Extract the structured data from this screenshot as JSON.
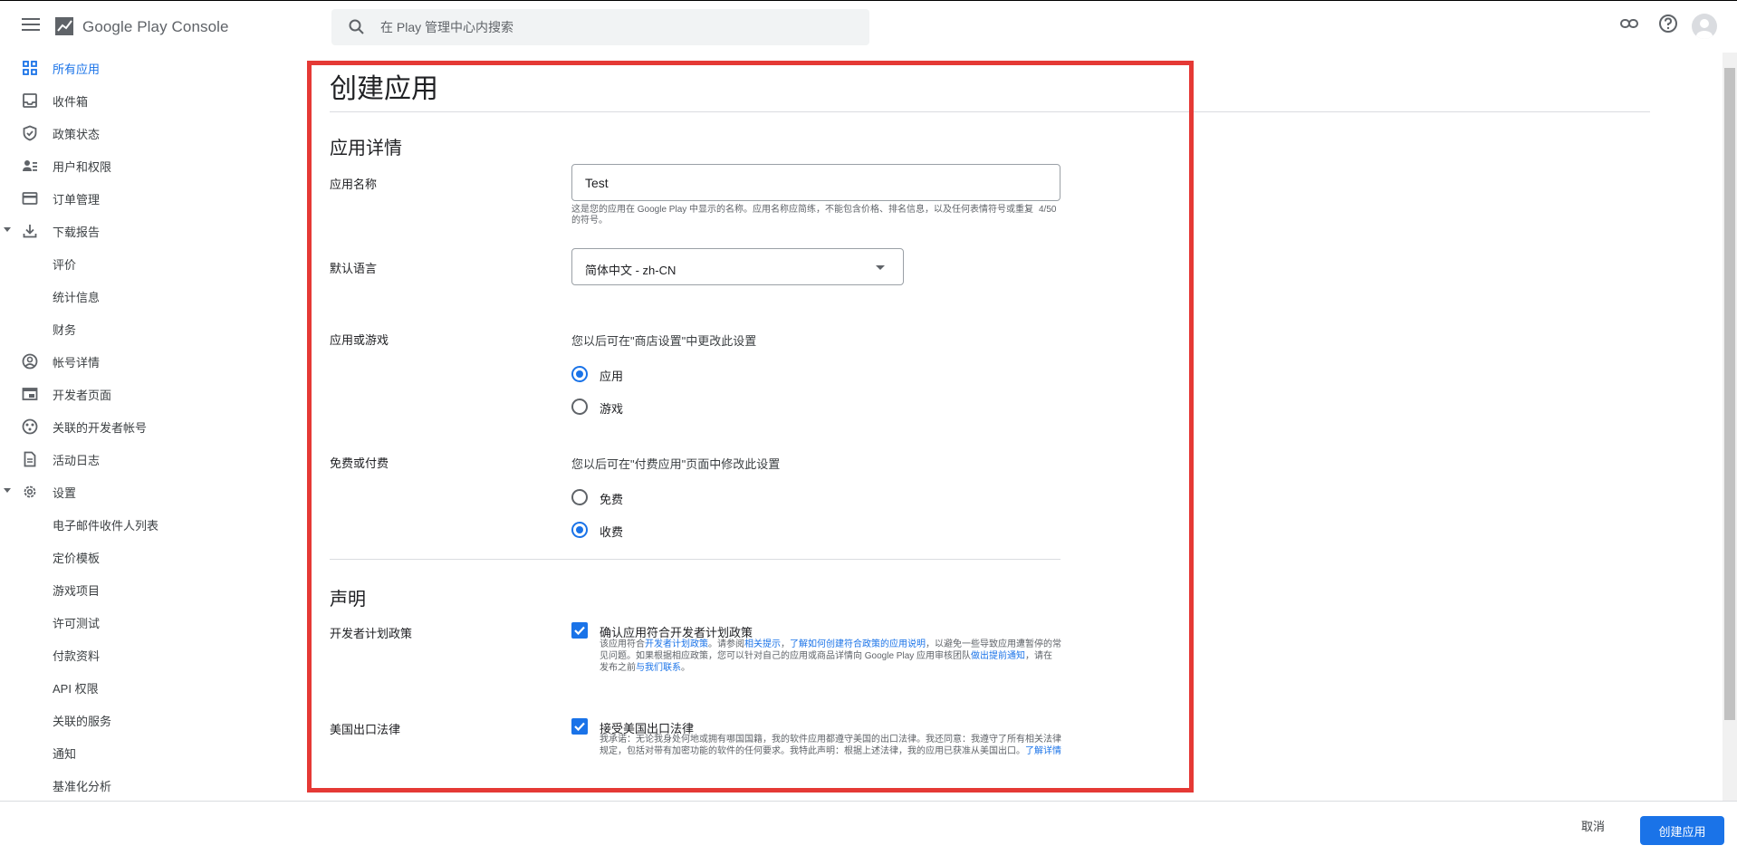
{
  "header": {
    "product_name": "Google Play Console",
    "search_placeholder": "在 Play 管理中心内搜索"
  },
  "sidebar": {
    "items": [
      {
        "label": "所有应用",
        "icon": "grid-icon",
        "active": true
      },
      {
        "label": "收件箱",
        "icon": "inbox-icon"
      },
      {
        "label": "政策状态",
        "icon": "shield-icon"
      },
      {
        "label": "用户和权限",
        "icon": "people-icon"
      },
      {
        "label": "订单管理",
        "icon": "credit-card-icon"
      },
      {
        "label": "下载报告",
        "icon": "download-icon",
        "expanded": true
      },
      {
        "label": "评价",
        "sub": true
      },
      {
        "label": "统计信息",
        "sub": true
      },
      {
        "label": "财务",
        "sub": true
      },
      {
        "label": "帐号详情",
        "icon": "account-circle-icon"
      },
      {
        "label": "开发者页面",
        "icon": "web-icon"
      },
      {
        "label": "关联的开发者帐号",
        "icon": "linked-accounts-icon"
      },
      {
        "label": "活动日志",
        "icon": "document-icon"
      },
      {
        "label": "设置",
        "icon": "gear-icon",
        "expanded": true
      },
      {
        "label": "电子邮件收件人列表",
        "sub": true
      },
      {
        "label": "定价模板",
        "sub": true
      },
      {
        "label": "游戏项目",
        "sub": true
      },
      {
        "label": "许可测试",
        "sub": true
      },
      {
        "label": "付款资料",
        "sub": true
      },
      {
        "label": "API 权限",
        "sub": true
      },
      {
        "label": "关联的服务",
        "sub": true
      },
      {
        "label": "通知",
        "sub": true
      },
      {
        "label": "基准化分析",
        "sub": true
      }
    ]
  },
  "page": {
    "title": "创建应用",
    "app_details": {
      "heading": "应用详情",
      "name_label": "应用名称",
      "name_value": "Test",
      "name_help": "这是您的应用在 Google Play 中显示的名称。应用名称应简练，不能包含价格、排名信息，以及任何表情符号或重复的符号。",
      "name_counter": "4/50",
      "language_label": "默认语言",
      "language_value": "简体中文 - zh-CN",
      "type_label": "应用或游戏",
      "type_hint": "您以后可在\"商店设置\"中更改此设置",
      "type_options": [
        "应用",
        "游戏"
      ],
      "type_selected": "应用",
      "price_label": "免费或付费",
      "price_hint": "您以后可在\"付费应用\"页面中修改此设置",
      "price_options": [
        "免费",
        "收费"
      ],
      "price_selected": "收费"
    },
    "declarations": {
      "heading": "声明",
      "policy_label": "开发者计划政策",
      "policy_title": "确认应用符合开发者计划政策",
      "policy_desc_1": "该应用符合",
      "policy_link_1": "开发者计划政策",
      "policy_desc_2": "。请参阅",
      "policy_link_2": "相关提示",
      "policy_desc_3": "，",
      "policy_link_3": "了解如何创建符合政策的应用说明",
      "policy_desc_4": "，以避免一些导致应用遭暂停的常见问题。如果根据相应政策，您可以针对自己的应用或商品详情向 Google Play 应用审核团队",
      "policy_link_4": "做出提前通知",
      "policy_desc_5": "，请在发布之前",
      "policy_link_5": "与我们联系",
      "policy_desc_6": "。",
      "export_label": "美国出口法律",
      "export_title": "接受美国出口法律",
      "export_desc": "我承诺：无论我身处何地或拥有哪国国籍，我的软件应用都遵守美国的出口法律。我还同意：我遵守了所有相关法律规定，包括对带有加密功能的软件的任何要求。我特此声明：根据上述法律，我的应用已获准从美国出口。",
      "export_link": "了解详情"
    }
  },
  "footer": {
    "cancel_label": "取消",
    "create_label": "创建应用"
  },
  "colors": {
    "accent": "#1a73e8",
    "highlight_border": "#e53935"
  }
}
